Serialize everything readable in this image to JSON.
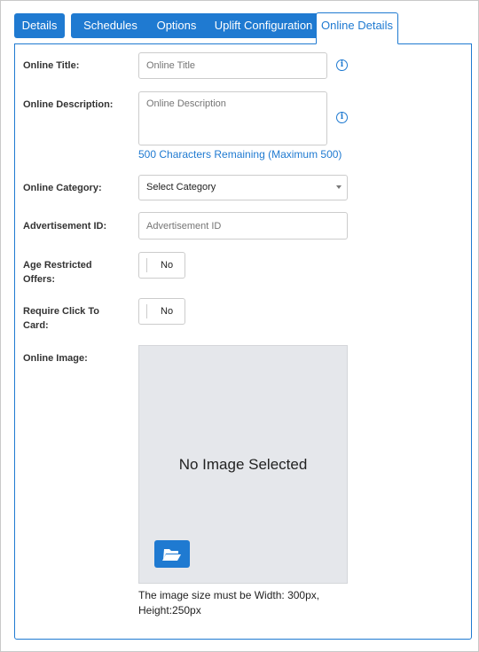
{
  "tabs": [
    {
      "label": "Details",
      "active": false
    },
    {
      "label": "Schedules",
      "active": false
    },
    {
      "label": "Options",
      "active": false
    },
    {
      "label": "Uplift Configuration",
      "active": false
    },
    {
      "label": "Online Details",
      "active": true
    }
  ],
  "form": {
    "online_title": {
      "label": "Online Title:",
      "placeholder": "Online Title",
      "value": ""
    },
    "online_description": {
      "label": "Online Description:",
      "placeholder": "Online Description",
      "value": "",
      "remaining": "500 Characters Remaining (Maximum 500)"
    },
    "online_category": {
      "label": "Online Category:",
      "selected": "Select Category"
    },
    "advertisement_id": {
      "label": "Advertisement ID:",
      "placeholder": "Advertisement ID",
      "value": ""
    },
    "age_restricted": {
      "label_line1": "Age Restricted",
      "label_line2": "Offers:",
      "value": "No"
    },
    "require_click": {
      "label_line1": "Require Click To",
      "label_line2": "Card:",
      "value": "No"
    },
    "online_image": {
      "label": "Online Image:",
      "placeholder_text": "No Image Selected",
      "note_line1": "The image size must be Width: 300px,",
      "note_line2": "Height:250px",
      "button_icon": "folder-open-icon"
    }
  },
  "info_icon_glyph": "i",
  "colors": {
    "accent": "#1f7ad1",
    "image_bg": "#e5e7eb"
  }
}
